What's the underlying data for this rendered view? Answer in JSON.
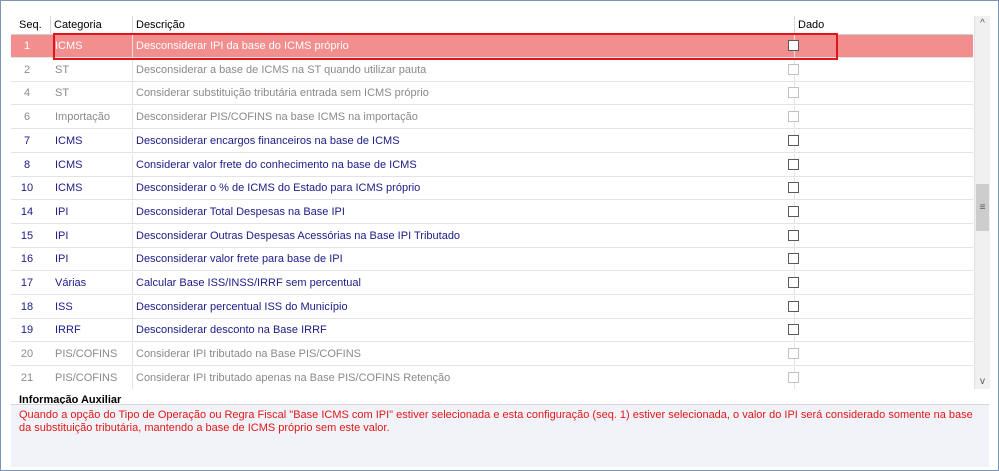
{
  "headers": {
    "seq": "Seq.",
    "category": "Categoria",
    "description": "Descrição",
    "value": "Dado"
  },
  "rows": [
    {
      "seq": "1",
      "category": "ICMS",
      "description": "Desconsiderar IPI da base do ICMS próprio",
      "state": "selected",
      "checked": false
    },
    {
      "seq": "2",
      "category": "ST",
      "description": "Desconsiderar a base de ICMS na ST quando utilizar pauta",
      "state": "disabled",
      "checked": false
    },
    {
      "seq": "4",
      "category": "ST",
      "description": "Considerar substituição tributária entrada sem ICMS próprio",
      "state": "disabled",
      "checked": false
    },
    {
      "seq": "6",
      "category": "Importação",
      "description": "Desconsiderar PIS/COFINS na base ICMS na importação",
      "state": "disabled",
      "checked": false
    },
    {
      "seq": "7",
      "category": "ICMS",
      "description": "Desconsiderar encargos financeiros na base de ICMS",
      "state": "active",
      "checked": false
    },
    {
      "seq": "8",
      "category": "ICMS",
      "description": "Considerar valor frete do conhecimento na base de ICMS",
      "state": "active",
      "checked": false
    },
    {
      "seq": "10",
      "category": "ICMS",
      "description": "Desconsiderar o % de ICMS do Estado para ICMS próprio",
      "state": "active",
      "checked": false
    },
    {
      "seq": "14",
      "category": "IPI",
      "description": "Desconsiderar Total Despesas na Base IPI",
      "state": "active",
      "checked": false
    },
    {
      "seq": "15",
      "category": "IPI",
      "description": "Desconsiderar Outras Despesas Acessórias na Base IPI Tributado",
      "state": "active",
      "checked": false
    },
    {
      "seq": "16",
      "category": "IPI",
      "description": "Desconsiderar valor frete para base de IPI",
      "state": "active",
      "checked": false
    },
    {
      "seq": "17",
      "category": "Várias",
      "description": "Calcular Base ISS/INSS/IRRF sem percentual",
      "state": "active",
      "checked": false
    },
    {
      "seq": "18",
      "category": "ISS",
      "description": "Desconsiderar percentual ISS do Município",
      "state": "active",
      "checked": false
    },
    {
      "seq": "19",
      "category": "IRRF",
      "description": "Desconsiderar desconto na Base IRRF",
      "state": "active",
      "checked": false
    },
    {
      "seq": "20",
      "category": "PIS/COFINS",
      "description": "Considerar IPI tributado na Base PIS/COFINS",
      "state": "disabled",
      "checked": false
    },
    {
      "seq": "21",
      "category": "PIS/COFINS",
      "description": "Considerar IPI tributado apenas na Base PIS/COFINS Retenção",
      "state": "disabled",
      "checked": false
    }
  ],
  "scrollbar": {
    "up": "^",
    "down": "v",
    "thumb": "≡"
  },
  "info": {
    "title": "Informação Auxiliar",
    "text": "Quando a opção do Tipo de Operação ou Regra Fiscal \"Base ICMS com IPI\" estiver selecionada e esta configuração (seq. 1) estiver selecionada, o valor do IPI será considerado somente na base da substituição tributária, mantendo a base de ICMS próprio sem este valor."
  },
  "colors": {
    "selected_row": "#f28e8e",
    "active_text": "#1b1b86",
    "disabled_text": "#8a8a8a",
    "info_text": "#e01818",
    "highlight_border": "#e0161d"
  }
}
